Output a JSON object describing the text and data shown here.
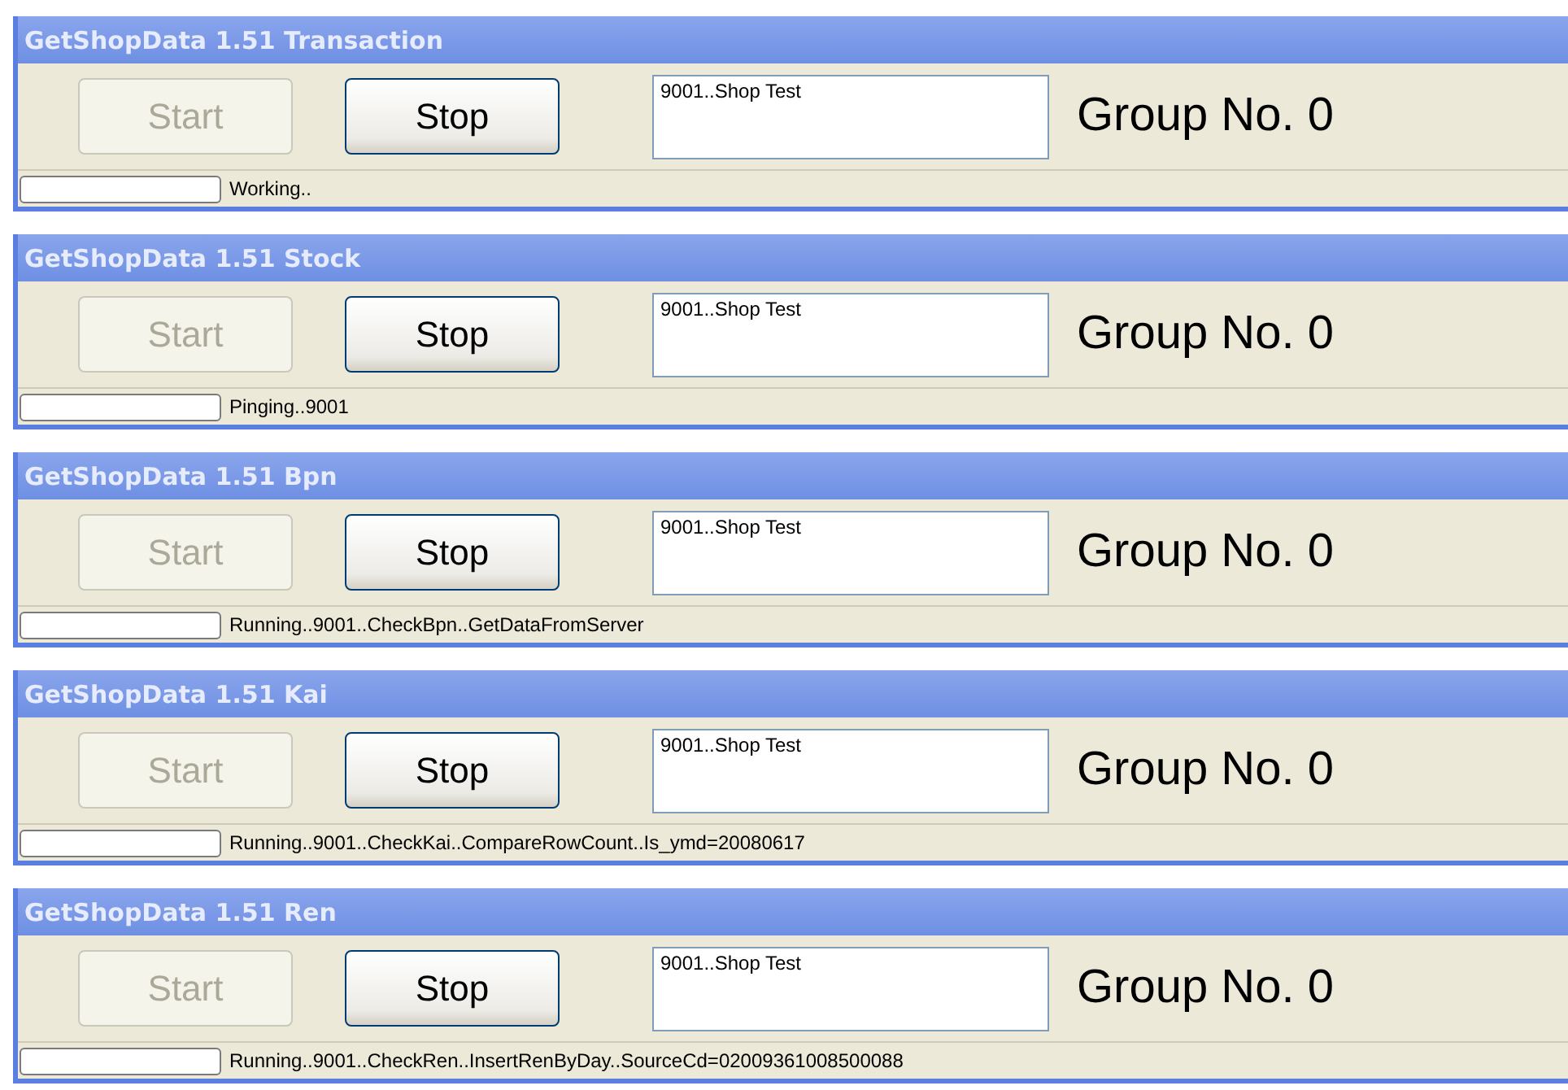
{
  "windows": [
    {
      "title": "GetShopData 1.51 Transaction",
      "buttons": [
        {
          "label": "Start",
          "disabled": true
        },
        {
          "label": "Stop",
          "disabled": false
        }
      ],
      "shop_field": {
        "value": "9001..Shop Test"
      },
      "group_label": "Group No. 0",
      "status_bar": {
        "progress": {
          "level": 0
        },
        "text": "Working.."
      }
    },
    {
      "title": "GetShopData 1.51 Stock",
      "buttons": [
        {
          "label": "Start",
          "disabled": true
        },
        {
          "label": "Stop",
          "disabled": false
        }
      ],
      "shop_field": {
        "value": "9001..Shop Test"
      },
      "group_label": "Group No. 0",
      "status_bar": {
        "progress": {
          "level": 0
        },
        "text": "Pinging..9001"
      }
    },
    {
      "title": "GetShopData 1.51 Bpn",
      "buttons": [
        {
          "label": "Start",
          "disabled": true
        },
        {
          "label": "Stop",
          "disabled": false
        }
      ],
      "shop_field": {
        "value": "9001..Shop Test"
      },
      "group_label": "Group No. 0",
      "status_bar": {
        "progress": {
          "level": 0
        },
        "text": "Running..9001..CheckBpn..GetDataFromServer"
      }
    },
    {
      "title": "GetShopData 1.51 Kai",
      "buttons": [
        {
          "label": "Start",
          "disabled": true
        },
        {
          "label": "Stop",
          "disabled": false
        }
      ],
      "shop_field": {
        "value": "9001..Shop Test"
      },
      "group_label": "Group No. 0",
      "status_bar": {
        "progress": {
          "level": 0
        },
        "text": "Running..9001..CheckKai..CompareRowCount..Is_ymd=20080617"
      }
    },
    {
      "title": "GetShopData 1.51 Ren",
      "buttons": [
        {
          "label": "Start",
          "disabled": true
        },
        {
          "label": "Stop",
          "disabled": false
        }
      ],
      "shop_field": {
        "value": "9001..Shop Test"
      },
      "group_label": "Group No. 0",
      "status_bar": {
        "progress": {
          "level": 0
        },
        "text": "Running..9001..CheckRen..InsertRenByDay..SourceCd=02009361008500088"
      }
    }
  ]
}
